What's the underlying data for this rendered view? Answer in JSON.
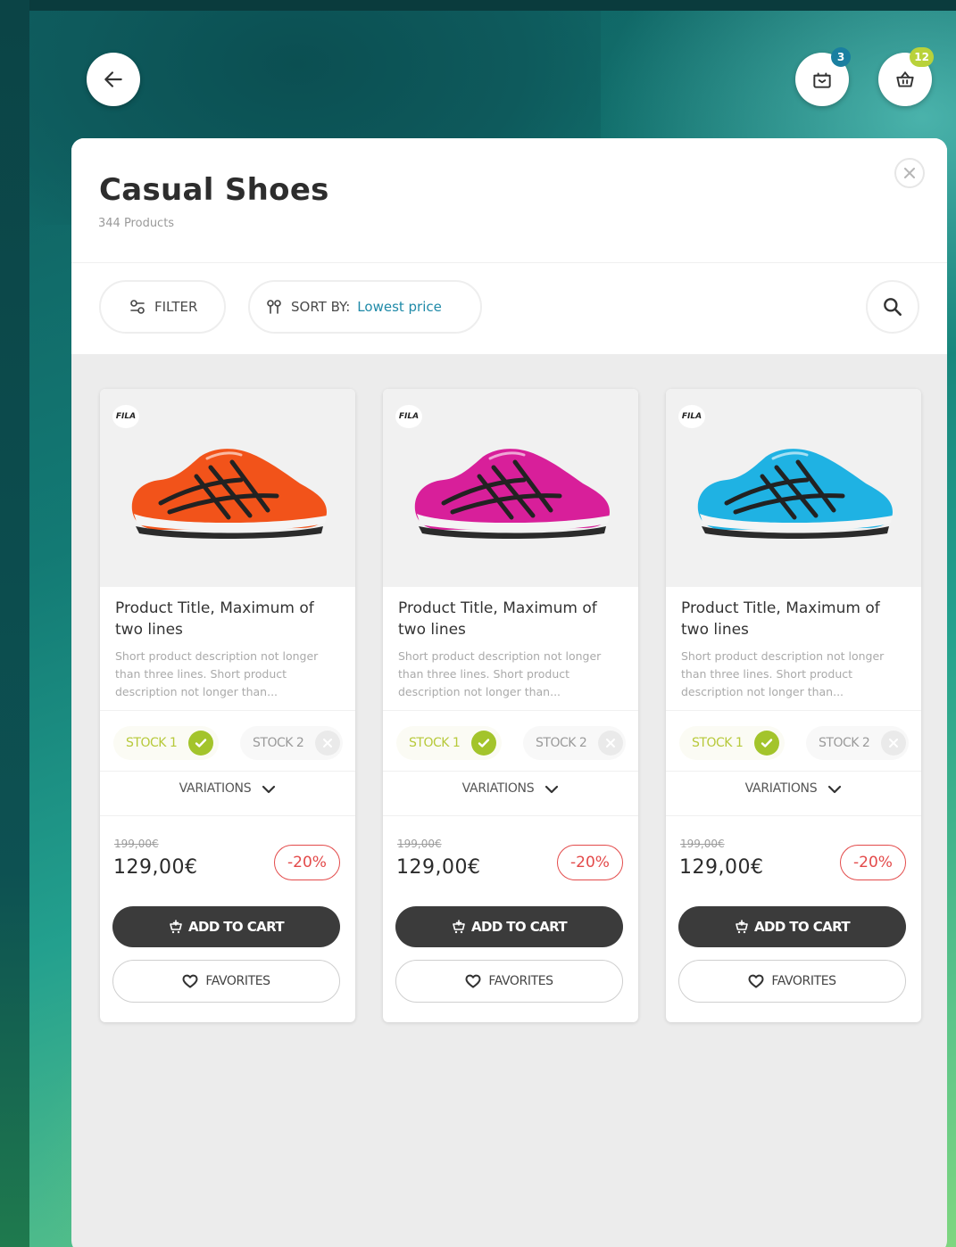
{
  "header": {
    "back_label": "back",
    "gift_badge": "3",
    "cart_badge": "12",
    "gift_badge_color": "#1a7fa0",
    "cart_badge_color": "#b9d23a"
  },
  "category": {
    "title": "Casual Shoes",
    "count": "344 Products"
  },
  "toolbar": {
    "filter_label": "FILTER",
    "sort_label": "SORT BY:",
    "sort_value": "Lowest price"
  },
  "products": [
    {
      "brand": "FILA",
      "shoe_color": "#f2531a",
      "title": "Product Title, Maximum of two lines",
      "description": "Short product description not longer than three lines. Short product description not longer than...",
      "stock1": "STOCK 1",
      "stock2": "STOCK 2",
      "variations": "VARIATIONS",
      "old_price": "199,00€",
      "price": "129,00€",
      "discount": "-20%",
      "add_to_cart": "ADD TO CART",
      "favorites": "FAVORITES"
    },
    {
      "brand": "FILA",
      "shoe_color": "#d81f9a",
      "title": "Product Title, Maximum of two lines",
      "description": "Short product description not longer than three lines. Short product description not longer than...",
      "stock1": "STOCK 1",
      "stock2": "STOCK 2",
      "variations": "VARIATIONS",
      "old_price": "199,00€",
      "price": "129,00€",
      "discount": "-20%",
      "add_to_cart": "ADD TO CART",
      "favorites": "FAVORITES"
    },
    {
      "brand": "FILA",
      "shoe_color": "#1fb2e3",
      "title": "Product Title, Maximum of two lines",
      "description": "Short product description not longer than three lines. Short product description not longer than...",
      "stock1": "STOCK 1",
      "stock2": "STOCK 2",
      "variations": "VARIATIONS",
      "old_price": "199,00€",
      "price": "129,00€",
      "discount": "-20%",
      "add_to_cart": "ADD TO CART",
      "favorites": "FAVORITES"
    }
  ]
}
